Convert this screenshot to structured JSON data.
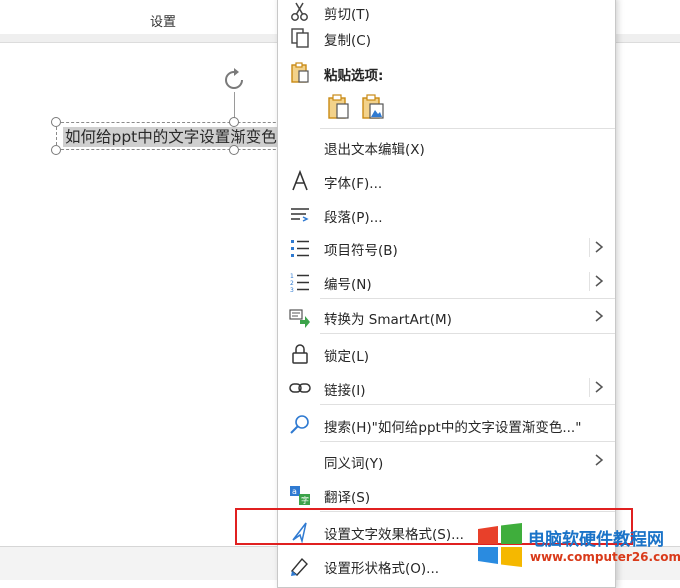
{
  "ribbon": {
    "group_label": "设置"
  },
  "slide": {
    "textbox_text": "如何给ppt中的文字设置渐变色"
  },
  "menu": {
    "cut": "剪切(T)",
    "copy": "复制(C)",
    "paste_options": "粘贴选项:",
    "items": [
      {
        "label": "退出文本编辑(X)"
      },
      {
        "label": "字体(F)..."
      },
      {
        "label": "段落(P)..."
      },
      {
        "label": "项目符号(B)"
      },
      {
        "label": "编号(N)"
      },
      {
        "label": "转换为 SmartArt(M)"
      },
      {
        "label": "锁定(L)"
      },
      {
        "label": "链接(I)"
      },
      {
        "label": "搜索(H)\"如何给ppt中的文字设置渐变色...\""
      },
      {
        "label": "同义词(Y)"
      },
      {
        "label": "翻译(S)"
      },
      {
        "label": "设置文字效果格式(S)..."
      },
      {
        "label": "设置形状格式(O)..."
      }
    ]
  },
  "watermark": {
    "title": "电脑软硬件教程网",
    "url": "www.computer26.com"
  },
  "colors": {
    "highlight": "#e02020",
    "accent_blue": "#1a73c8",
    "icon_gold": "#c98a14"
  }
}
